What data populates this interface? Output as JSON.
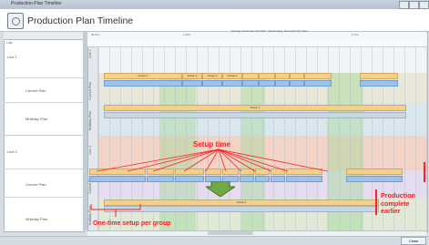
{
  "window": {
    "title": "Production Plan Timeline"
  },
  "app": {
    "title": "Production Plan Timeline"
  },
  "left": {
    "header": "Line",
    "line1": "Line 1",
    "line2": "Line 2",
    "current_plan": "Current Plan",
    "multiday_plan": "Multiday Plan"
  },
  "timeline": {
    "date_range": "Sunday, November 30, 2014 - Wednesday, December 03, 2014",
    "day1": "30 Sun",
    "day2": "1 Mon",
    "day3": "2 Tue"
  },
  "annotations": {
    "setup_time": "Setup time",
    "one_time": "One-time setup per group",
    "complete": "Production complete earlier"
  },
  "footer": {
    "ok": "Close"
  }
}
